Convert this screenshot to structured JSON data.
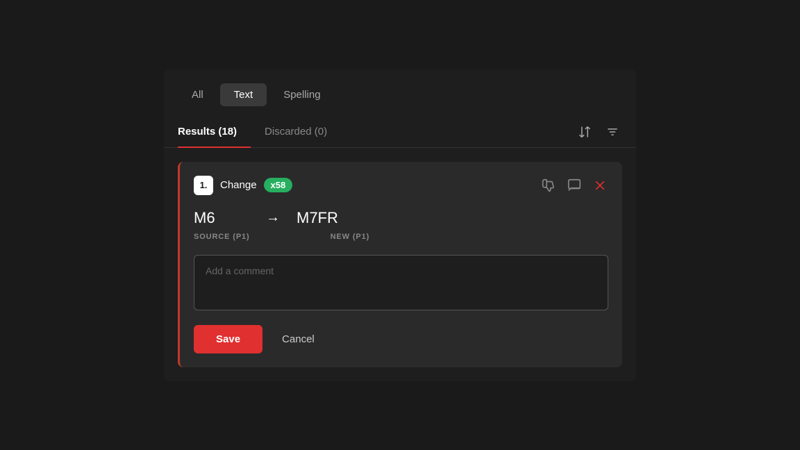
{
  "tabs": {
    "all_label": "All",
    "text_label": "Text",
    "spelling_label": "Spelling",
    "active": "Text"
  },
  "results": {
    "results_label": "Results (18)",
    "discarded_label": "Discarded (0)"
  },
  "card": {
    "number": "1.",
    "change_label": "Change",
    "badge_count": "x58",
    "source_value": "M6",
    "new_value": "M7FR",
    "source_label": "SOURCE (P1)",
    "new_label": "NEW (P1)",
    "comment_placeholder": "Add a comment",
    "save_label": "Save",
    "cancel_label": "Cancel"
  },
  "icons": {
    "dislike": "👎",
    "comment": "💬",
    "close": "✕",
    "sort": "⇅",
    "filter": "≡",
    "arrow_right": "→"
  }
}
